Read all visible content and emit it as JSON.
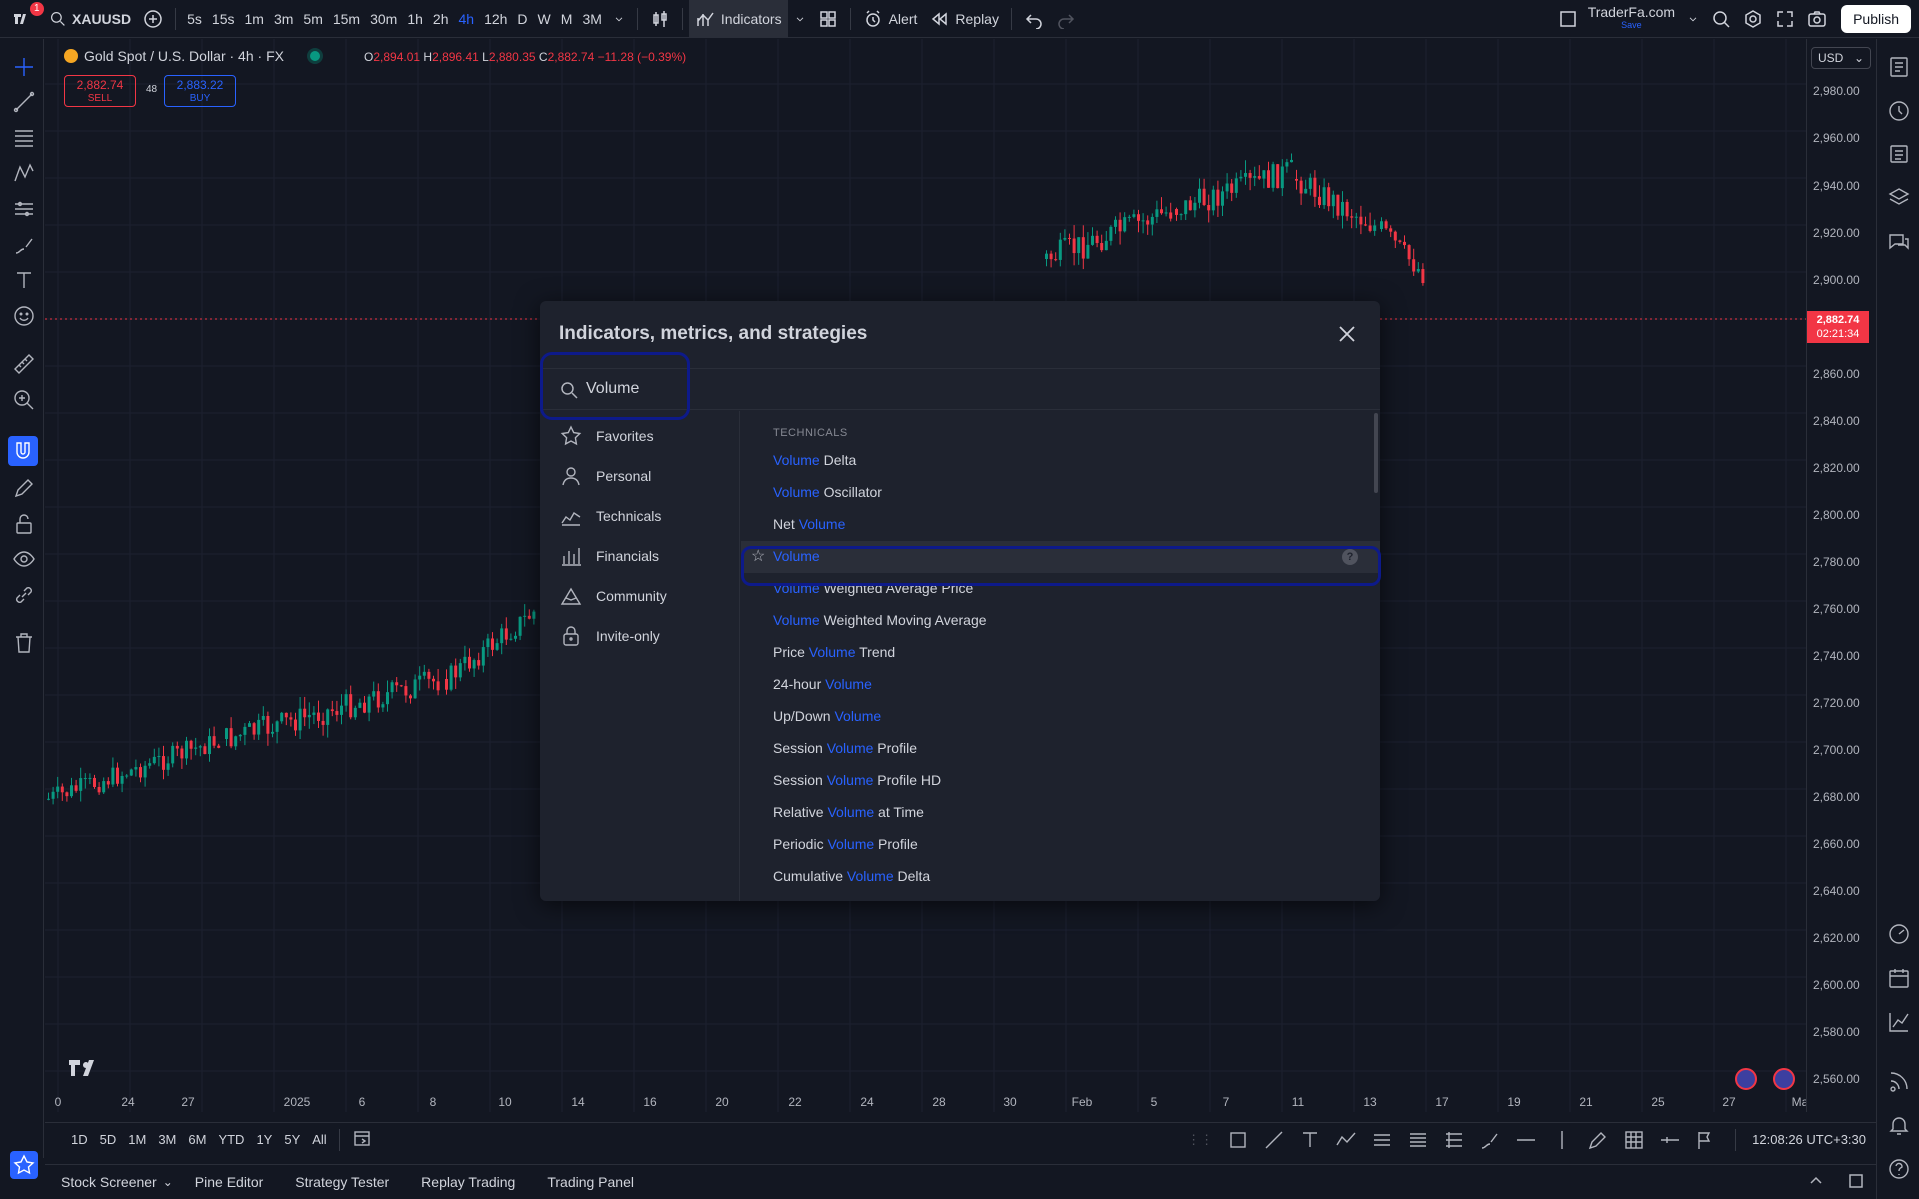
{
  "topbar": {
    "notification_count": "1",
    "symbol": "XAUUSD",
    "timeframes": [
      "5s",
      "15s",
      "1m",
      "3m",
      "5m",
      "15m",
      "30m",
      "1h",
      "2h",
      "4h",
      "12h",
      "D",
      "W",
      "M",
      "3M"
    ],
    "active_timeframe": "4h",
    "indicators_label": "Indicators",
    "alert_label": "Alert",
    "replay_label": "Replay",
    "layout_name": "TraderFa.com",
    "layout_save": "Save",
    "publish_label": "Publish"
  },
  "chart_header": {
    "title": "Gold Spot / U.S. Dollar · 4h · FX",
    "ohlc_o_label": "O",
    "ohlc_o": "2,894.01",
    "ohlc_h_label": "H",
    "ohlc_h": "2,896.41",
    "ohlc_l_label": "L",
    "ohlc_l": "2,880.35",
    "ohlc_c_label": "C",
    "ohlc_c": "2,882.74",
    "ohlc_change": "−11.28 (−0.39%)",
    "sell_price": "2,882.74",
    "sell_label": "SELL",
    "spread": "48",
    "buy_price": "2,883.22",
    "buy_label": "BUY"
  },
  "price_axis": {
    "currency": "USD",
    "labels": [
      "2,980.00",
      "2,960.00",
      "2,940.00",
      "2,920.00",
      "2,900.00",
      "2,860.00",
      "2,840.00",
      "2,820.00",
      "2,800.00",
      "2,780.00",
      "2,760.00",
      "2,740.00",
      "2,720.00",
      "2,700.00",
      "2,680.00",
      "2,660.00",
      "2,640.00",
      "2,620.00",
      "2,600.00",
      "2,580.00",
      "2,560.00"
    ],
    "current_price": "2,882.74",
    "countdown": "02:21:34"
  },
  "time_axis": {
    "labels": [
      "0",
      "24",
      "27",
      "2025",
      "6",
      "8",
      "10",
      "14",
      "16",
      "20",
      "22",
      "24",
      "28",
      "30",
      "Feb",
      "5",
      "7",
      "11",
      "13",
      "17",
      "19",
      "21",
      "25",
      "27",
      "Ma"
    ]
  },
  "bottom_range": {
    "ranges": [
      "1D",
      "5D",
      "1M",
      "3M",
      "6M",
      "YTD",
      "1Y",
      "5Y",
      "All"
    ],
    "clock": "12:08:26 UTC+3:30"
  },
  "bottom_panel": {
    "tabs": [
      "Stock Screener",
      "Pine Editor",
      "Strategy Tester",
      "Replay Trading",
      "Trading Panel"
    ]
  },
  "modal": {
    "title": "Indicators, metrics, and strategies",
    "search_value": "Volume",
    "categories": [
      "Favorites",
      "Personal",
      "Technicals",
      "Financials",
      "Community",
      "Invite-only"
    ],
    "section": "TECHNICALS",
    "results": [
      {
        "pre": "",
        "hl": "Volume",
        "post": " Delta"
      },
      {
        "pre": "",
        "hl": "Volume",
        "post": " Oscillator"
      },
      {
        "pre": "Net ",
        "hl": "Volume",
        "post": ""
      },
      {
        "pre": "",
        "hl": "Volume",
        "post": ""
      },
      {
        "pre": "",
        "hl": "Volume",
        "post": " Weighted Average Price"
      },
      {
        "pre": "",
        "hl": "Volume",
        "post": " Weighted Moving Average"
      },
      {
        "pre": "Price ",
        "hl": "Volume",
        "post": " Trend"
      },
      {
        "pre": "24-hour ",
        "hl": "Volume",
        "post": ""
      },
      {
        "pre": "Up/Down ",
        "hl": "Volume",
        "post": ""
      },
      {
        "pre": "Session ",
        "hl": "Volume",
        "post": " Profile"
      },
      {
        "pre": "Session ",
        "hl": "Volume",
        "post": " Profile HD"
      },
      {
        "pre": "Relative ",
        "hl": "Volume",
        "post": " at Time"
      },
      {
        "pre": "Periodic ",
        "hl": "Volume",
        "post": " Profile"
      },
      {
        "pre": "Cumulative ",
        "hl": "Volume",
        "post": " Delta"
      }
    ],
    "selected_index": 3
  },
  "colors": {
    "up": "#089981",
    "down": "#f23645",
    "accent": "#2962ff",
    "highlight_outline": "#0d1a8a"
  }
}
